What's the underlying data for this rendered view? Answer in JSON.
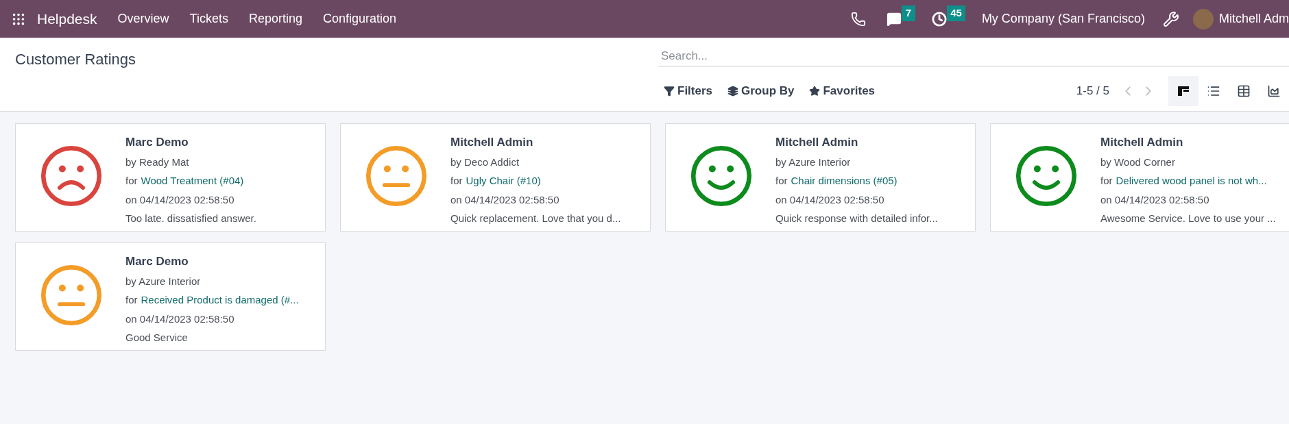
{
  "navbar": {
    "app_name": "Helpdesk",
    "menu": [
      "Overview",
      "Tickets",
      "Reporting",
      "Configuration"
    ],
    "messages_count": "7",
    "activities_count": "45",
    "company": "My Company (San Francisco)",
    "user": "Mitchell Adm"
  },
  "control_panel": {
    "title": "Customer Ratings",
    "search": {
      "placeholder": "Search..."
    },
    "filters": [
      "Filters",
      "Group By",
      "Favorites"
    ],
    "pager": "1-5 / 5",
    "views": [
      {
        "kind": "kanban",
        "selected": true
      },
      {
        "kind": "list",
        "selected": false
      },
      {
        "kind": "pivot",
        "selected": false
      },
      {
        "kind": "graph",
        "selected": false
      }
    ]
  },
  "cards": [
    {
      "kind": "unhappy",
      "name": "Marc Demo",
      "by": "by Ready Mat",
      "for_label": "for",
      "ticket": "Wood Treatment (#04)",
      "date": "on 04/14/2023 02:58:50",
      "feedback": "Too late. dissatisfied answer."
    },
    {
      "kind": "okay",
      "name": "Mitchell Admin",
      "by": "by Deco Addict",
      "for_label": "for",
      "ticket": "Ugly Chair (#10)",
      "date": "on 04/14/2023 02:58:50",
      "feedback": "Quick replacement. Love that you d..."
    },
    {
      "kind": "happy",
      "name": "Mitchell Admin",
      "by": "by Azure Interior",
      "for_label": "for",
      "ticket": "Chair dimensions (#05)",
      "date": "on 04/14/2023 02:58:50",
      "feedback": "Quick response with detailed infor..."
    },
    {
      "kind": "happy",
      "name": "Mitchell Admin",
      "by": "by Wood Corner",
      "for_label": "for",
      "ticket": "Delivered wood panel is not wh...",
      "date": "on 04/14/2023 02:58:50",
      "feedback": "Awesome Service. Love to use your ..."
    },
    {
      "kind": "okay",
      "name": "Marc Demo",
      "by": "by Azure Interior",
      "for_label": "for",
      "ticket": "Received Product is damaged (#...",
      "date": "on 04/14/2023 02:58:50",
      "feedback": "Good Service"
    }
  ]
}
